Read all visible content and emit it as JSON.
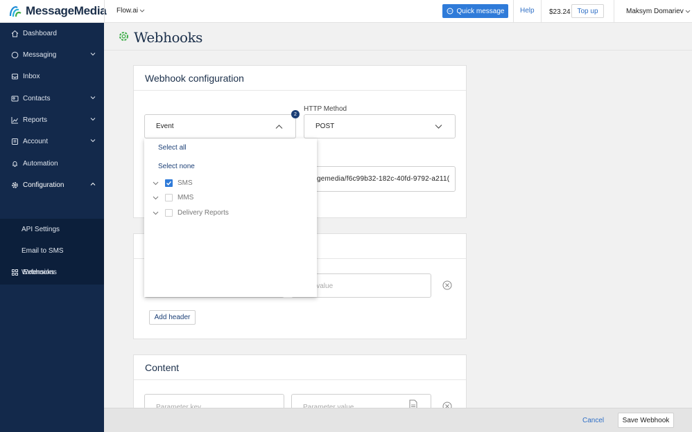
{
  "brand": {
    "name": "MessageMedia"
  },
  "topbar": {
    "account": "Flow.ai",
    "quick_message": "Quick message",
    "help": "Help",
    "balance": "$23.24",
    "top_up": "Top up",
    "user": "Maksym Domariev"
  },
  "sidebar": {
    "items": [
      {
        "label": "Dashboard"
      },
      {
        "label": "Messaging"
      },
      {
        "label": "Inbox"
      },
      {
        "label": "Contacts"
      },
      {
        "label": "Reports"
      },
      {
        "label": "Account"
      },
      {
        "label": "Automation"
      },
      {
        "label": "Configuration"
      },
      {
        "label": "Extensions"
      }
    ],
    "subitems": [
      {
        "label": "API Settings"
      },
      {
        "label": "Email to SMS"
      },
      {
        "label": "Webhooks"
      }
    ]
  },
  "page": {
    "title": "Webhooks"
  },
  "config_card": {
    "title": "Webhook configuration",
    "event_select": {
      "value": "Event",
      "badge": "2"
    },
    "http_method": {
      "label": "HTTP Method",
      "value": "POST"
    },
    "url_value": "gemedia/f6c99b32-182c-40fd-9792-a211("
  },
  "event_dropdown": {
    "select_all": "Select all",
    "select_none": "Select none",
    "options": [
      {
        "label": "SMS",
        "checked": true
      },
      {
        "label": "MMS",
        "checked": false
      },
      {
        "label": "Delivery Reports",
        "checked": false
      }
    ]
  },
  "headers_card": {
    "header_value_placeholder": "der value",
    "add_header": "Add header"
  },
  "content_card": {
    "title": "Content",
    "param_key_placeholder": "Parameter key",
    "param_value_placeholder": "Parameter value"
  },
  "footer": {
    "cancel": "Cancel",
    "save": "Save Webhook"
  },
  "colors": {
    "sidebar": "#13294b",
    "primary": "#2f7bd9",
    "accent_green": "#3fae49"
  }
}
